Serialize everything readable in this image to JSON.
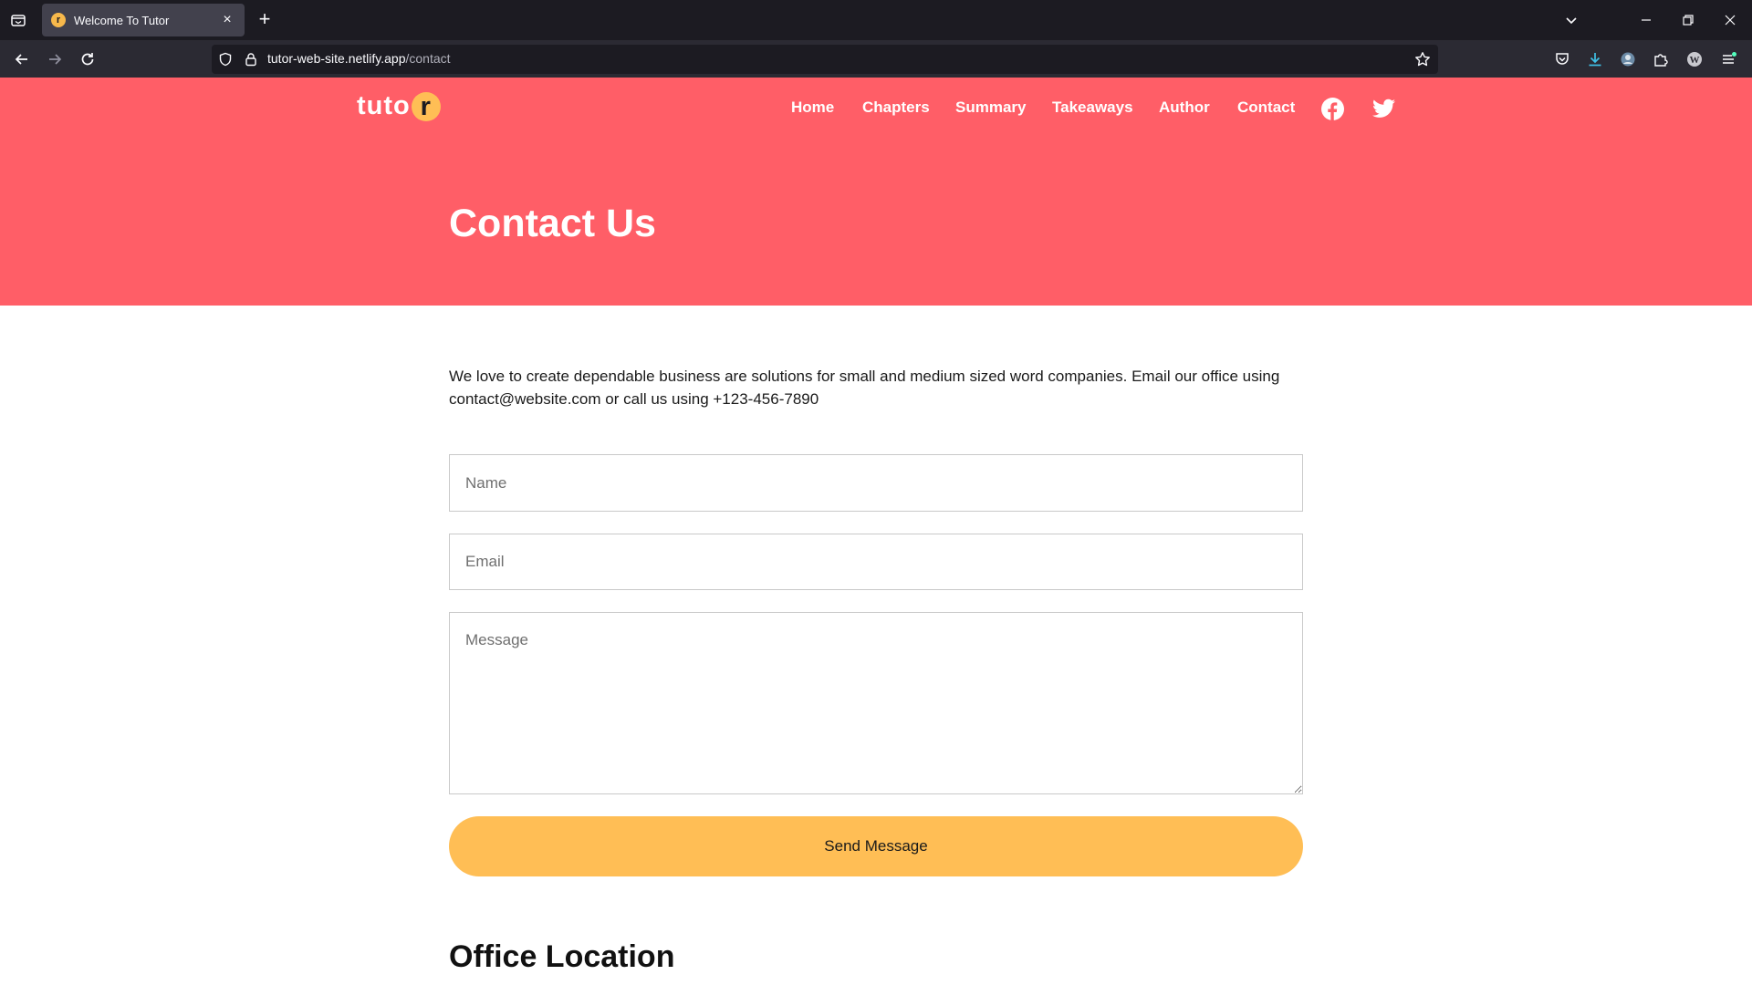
{
  "browser": {
    "tab": {
      "favicon": "r",
      "title": "Welcome To Tutor",
      "close": "×"
    },
    "new_tab": "+",
    "url": {
      "host": "tutor-web-site.netlify.app",
      "path": "/contact"
    },
    "icons": [
      "list-all-tabs-icon",
      "back-icon",
      "forward-icon",
      "reload-icon",
      "shield-icon",
      "lock-icon",
      "bookmark-star-icon",
      "pocket-icon",
      "download-icon",
      "account-icon",
      "extensions-icon",
      "wordpress-icon",
      "menu-icon",
      "minimize-icon",
      "restore-icon",
      "close-window-icon"
    ]
  },
  "site": {
    "logo": {
      "text": "tuto",
      "accent": "r"
    },
    "nav": [
      {
        "label": "Home"
      },
      {
        "label": "Chapters"
      },
      {
        "label": "Summary"
      },
      {
        "label": "Takeaways"
      },
      {
        "label": "Author"
      },
      {
        "label": "Contact"
      }
    ],
    "social": [
      "facebook-icon",
      "twitter-icon"
    ],
    "hero_title": "Contact Us",
    "colors": {
      "header": "#ff5e67",
      "accent": "#ffbe55",
      "white": "#ffffff"
    }
  },
  "contact": {
    "intro": "We love to create dependable business are solutions for small and medium sized word companies. Email our office using contact@website.com or call us using +123-456-7890",
    "name_placeholder": "Name",
    "email_placeholder": "Email",
    "message_placeholder": "Message",
    "send_label": "Send Message"
  },
  "office": {
    "title": "Office Location"
  }
}
